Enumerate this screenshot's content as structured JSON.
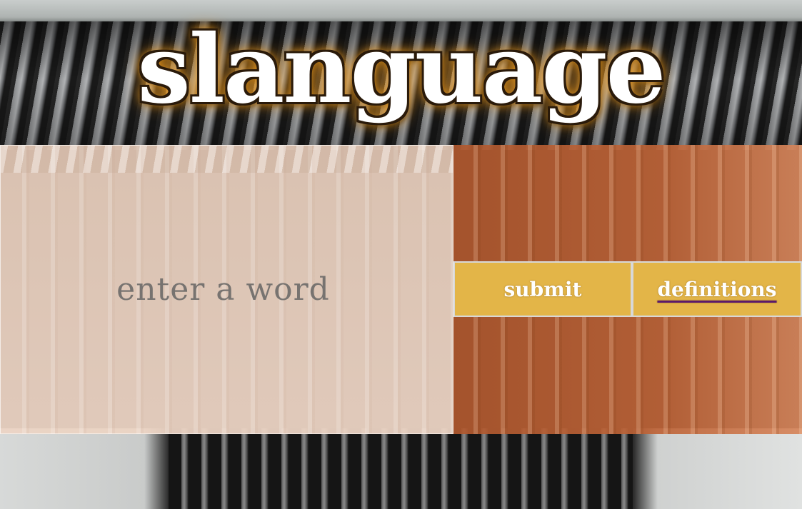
{
  "app": {
    "title": "slanguage"
  },
  "form": {
    "word_input": {
      "placeholder": "enter a word",
      "value": ""
    },
    "submit_label": "submit",
    "definitions_label": "definitions"
  },
  "colors": {
    "title_glow": "#f0a020",
    "input_panel": "#ecd4c4",
    "right_panel": "#b8623a",
    "button": "#e3b548",
    "link_underline": "#5a1a6a"
  }
}
